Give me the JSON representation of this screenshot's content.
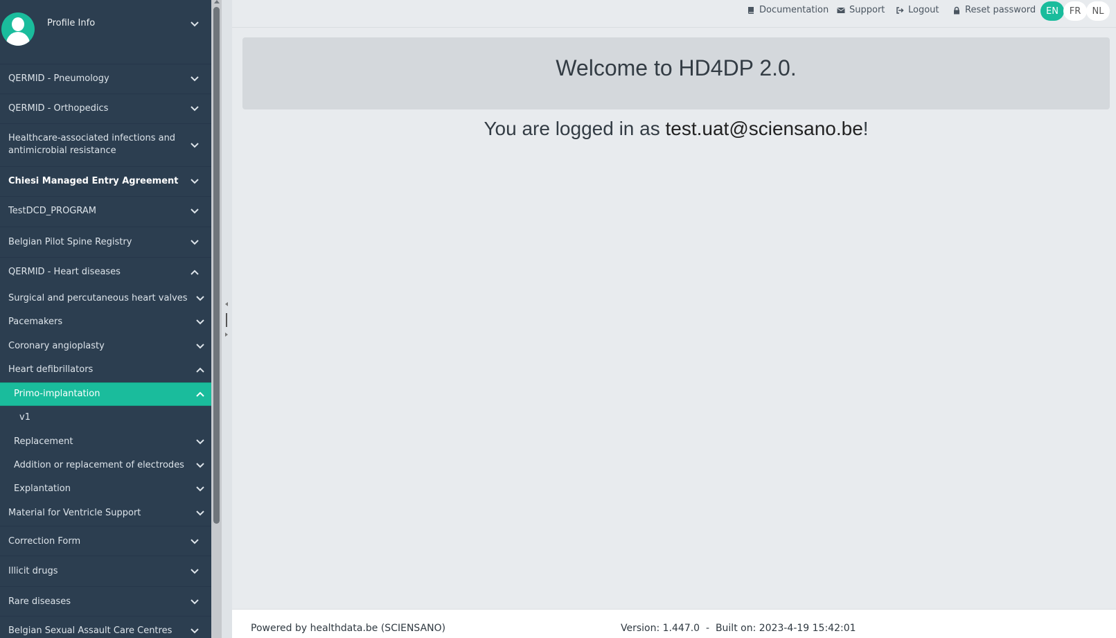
{
  "profile": {
    "label": "Profile Info"
  },
  "nav": [
    {
      "label": "QERMID - Pneumology"
    },
    {
      "label": "QERMID - Orthopedics"
    },
    {
      "label_line1": "Healthcare-associated infections and",
      "label_line2": "antimicrobial resistance"
    },
    {
      "label": "Chiesi Managed Entry Agreement"
    },
    {
      "label": "TestDCD_PROGRAM"
    },
    {
      "label": "Belgian Pilot Spine Registry"
    },
    {
      "label": "QERMID - Heart diseases"
    }
  ],
  "heart_sub": [
    {
      "label": "Surgical and percutaneous heart valves"
    },
    {
      "label": "Pacemakers"
    },
    {
      "label": "Coronary angioplasty"
    },
    {
      "label": "Heart defibrillators"
    }
  ],
  "defib_sub": [
    {
      "label": "Primo-implantation"
    },
    {
      "label": "v1"
    },
    {
      "label": "Replacement"
    },
    {
      "label": "Addition or replacement of electrodes"
    },
    {
      "label": "Explantation"
    }
  ],
  "heart_sub_after": {
    "label": "Material for Ventricle Support"
  },
  "nav_after": [
    {
      "label": "Correction Form"
    },
    {
      "label": "Illicit drugs"
    },
    {
      "label": "Rare diseases"
    },
    {
      "label": "Belgian Sexual Assault Care Centres"
    }
  ],
  "topbar": {
    "documentation": "Documentation",
    "support": "Support",
    "logout": "Logout",
    "reset_password": "Reset password",
    "langs": [
      "EN",
      "FR",
      "NL"
    ],
    "active_lang": "EN"
  },
  "main": {
    "welcome": "Welcome to HD4DP 2.0.",
    "logged_prefix": "You are logged in as ",
    "email": "test.uat@sciensano.be",
    "logged_suffix": "!"
  },
  "footer": {
    "powered": "Powered by healthdata.be (SCIENSANO)",
    "version": "Version: 1.447.0  -  Built on: 2023-4-19 15:42:01"
  },
  "colors": {
    "sidebar": "#2c3e50",
    "accent": "#1abc9c"
  }
}
